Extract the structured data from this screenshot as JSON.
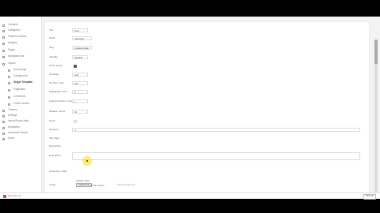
{
  "sidebar": {
    "items": [
      {
        "label": "Contents",
        "icon": "document-icon",
        "level": 0
      },
      {
        "label": "Categories",
        "icon": "folder-icon",
        "level": 0
      },
      {
        "label": "Featured articles",
        "icon": "star-icon",
        "level": 0
      },
      {
        "label": "Widgets",
        "icon": "widget-icon",
        "level": 0
      },
      {
        "label": "Pages",
        "icon": "page-icon",
        "level": 0
      },
      {
        "label": "Navigation bar",
        "icon": "menu-icon",
        "level": 0
      },
      {
        "label": "Layout",
        "icon": "layout-icon",
        "level": 0
      },
      {
        "label": "Home page",
        "icon": "circle-icon",
        "level": 1
      },
      {
        "label": "Category list",
        "icon": "circle-icon",
        "level": 1
      },
      {
        "label": "Single Template",
        "icon": "circle-icon",
        "level": 1,
        "active": true
      },
      {
        "label": "Pagination",
        "icon": "circle-icon",
        "level": 1
      },
      {
        "label": "Comments",
        "icon": "circle-icon",
        "level": 1
      },
      {
        "label": "Footer section",
        "icon": "circle-icon",
        "level": 1
      },
      {
        "label": "Themes",
        "icon": "palette-icon",
        "level": 0
      },
      {
        "label": "Settings",
        "icon": "gear-icon",
        "level": 0
      },
      {
        "label": "Import/Export data",
        "icon": "transfer-icon",
        "level": 0
      },
      {
        "label": "Newsletter",
        "icon": "mail-icon",
        "level": 0
      },
      {
        "label": "Advanced Search",
        "icon": "search-icon",
        "level": 0
      },
      {
        "label": "Users",
        "icon": "user-icon",
        "level": 0
      }
    ]
  },
  "form": {
    "fields": [
      {
        "label": "Title",
        "type": "input",
        "value": "Post",
        "width": 20
      },
      {
        "label": "Prefix",
        "type": "input",
        "value": "mainpage",
        "width": 25
      },
      {
        "label": "Slug",
        "type": "input",
        "value": "singletemplate",
        "width": 25
      },
      {
        "label": "Variable",
        "type": "input",
        "value": "Variable",
        "width": 20
      },
      {
        "label": "Active status",
        "type": "checkbox",
        "checked": true
      },
      {
        "label": "Template",
        "type": "input",
        "value": "post",
        "width": 20
      },
      {
        "label": "Number / Item",
        "type": "input",
        "value": "100",
        "width": 20
      },
      {
        "label": "Highlighted / item",
        "type": "input",
        "value": "0",
        "width": 20
      },
      {
        "label": "Featured article / post",
        "type": "input",
        "value": "1",
        "width": 20
      },
      {
        "label": "Related / items",
        "type": "input",
        "value": "10",
        "width": 20
      },
      {
        "label": "Reset",
        "type": "checkbox",
        "checked": false
      },
      {
        "label": "Keyword",
        "type": "input",
        "value": "3",
        "width": 364
      },
      {
        "label": "Title Tags",
        "type": "text",
        "value": ""
      },
      {
        "label": "Description",
        "type": "text",
        "value": ""
      },
      {
        "label": "Description",
        "type": "bigtext",
        "value": ""
      },
      {
        "label": "Structured / data",
        "type": "text",
        "value": ""
      },
      {
        "label": "Image",
        "type": "file",
        "value": "No file chosen"
      }
    ],
    "image_button": "Choose File",
    "image_note": "Recommended size",
    "upload_label": "Upload image"
  },
  "download_bar": {
    "file_name": "Document.pdf",
    "show_all": "Show all"
  }
}
